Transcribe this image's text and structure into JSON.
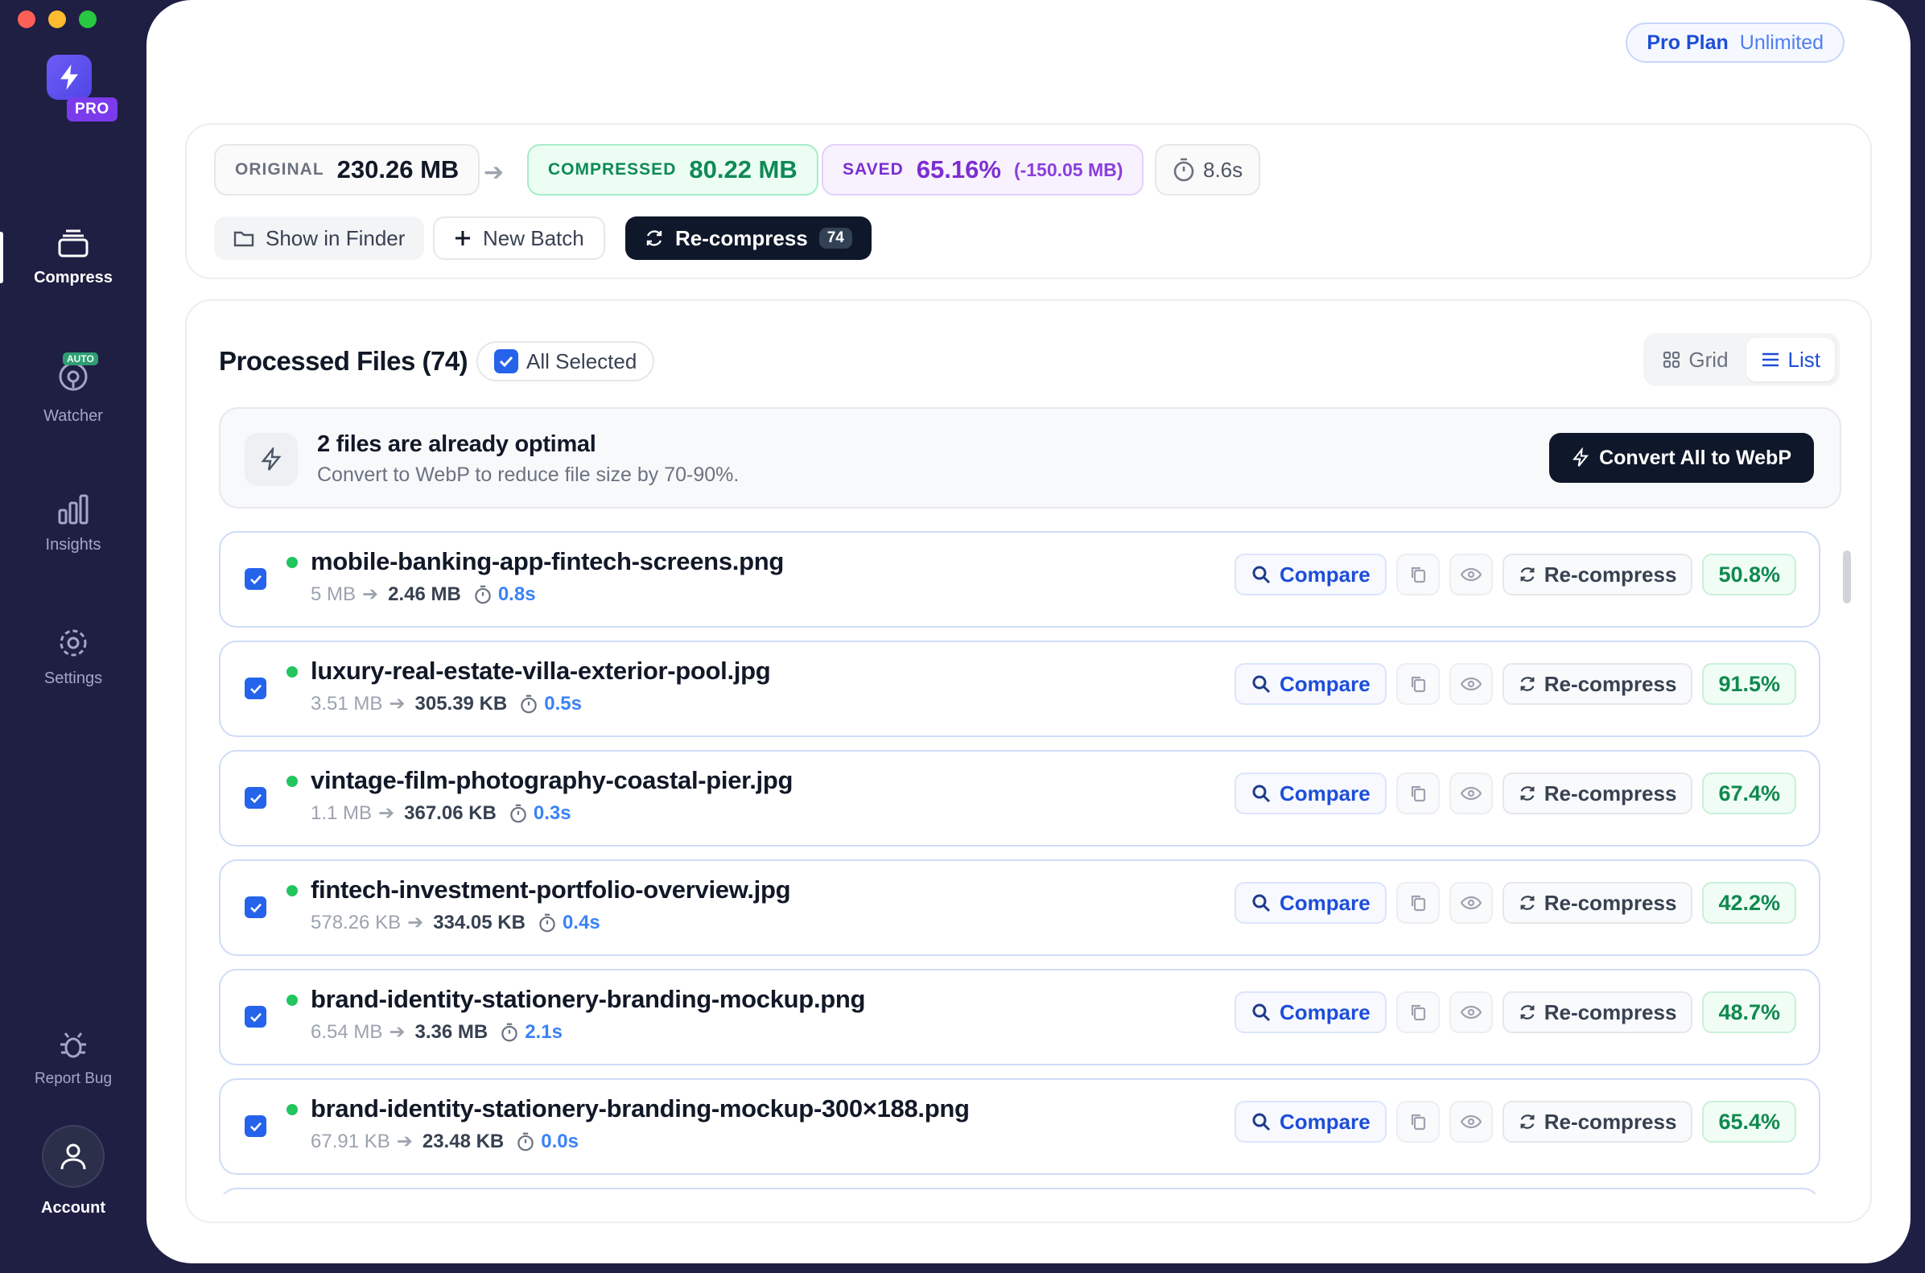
{
  "plan": {
    "name": "Pro Plan",
    "tier": "Unlimited"
  },
  "sidebar": {
    "pro_badge": "PRO",
    "auto_tag": "AUTO",
    "items": [
      {
        "label": "Compress",
        "icon": "stack-icon",
        "active": true
      },
      {
        "label": "Watcher",
        "icon": "watch-icon",
        "active": false
      },
      {
        "label": "Insights",
        "icon": "bar-chart-icon",
        "active": false
      },
      {
        "label": "Settings",
        "icon": "gear-icon",
        "active": false
      },
      {
        "label": "Report Bug",
        "icon": "bug-icon",
        "active": false
      },
      {
        "label": "Account",
        "icon": "user-icon",
        "active": false
      }
    ]
  },
  "stats": {
    "original_label": "ORIGINAL",
    "original_value": "230.26 MB",
    "compressed_label": "COMPRESSED",
    "compressed_value": "80.22 MB",
    "saved_label": "SAVED",
    "saved_value": "65.16%",
    "saved_delta": "(-150.05 MB)",
    "time_value": "8.6s"
  },
  "actions": {
    "show_in_finder": "Show in Finder",
    "new_batch": "New Batch",
    "recompress": "Re-compress",
    "recompress_count": "74"
  },
  "files": {
    "title": "Processed Files (74)",
    "all_selected": "All Selected",
    "view_grid": "Grid",
    "view_list": "List",
    "optimal_title": "2 files are already optimal",
    "optimal_sub": "Convert to WebP to reduce file size by 70-90%.",
    "convert_button": "Convert All to WebP",
    "compare_label": "Compare",
    "recompress_label": "Re-compress",
    "rows": [
      {
        "name": "mobile-banking-app-fintech-screens.png",
        "orig": "5 MB",
        "new": "2.46 MB",
        "time": "0.8s",
        "pct": "50.8%"
      },
      {
        "name": "luxury-real-estate-villa-exterior-pool.jpg",
        "orig": "3.51 MB",
        "new": "305.39 KB",
        "time": "0.5s",
        "pct": "91.5%"
      },
      {
        "name": "vintage-film-photography-coastal-pier.jpg",
        "orig": "1.1 MB",
        "new": "367.06 KB",
        "time": "0.3s",
        "pct": "67.4%"
      },
      {
        "name": "fintech-investment-portfolio-overview.jpg",
        "orig": "578.26 KB",
        "new": "334.05 KB",
        "time": "0.4s",
        "pct": "42.2%"
      },
      {
        "name": "brand-identity-stationery-branding-mockup.png",
        "orig": "6.54 MB",
        "new": "3.36 MB",
        "time": "2.1s",
        "pct": "48.7%"
      },
      {
        "name": "brand-identity-stationery-branding-mockup-300×188.png",
        "orig": "67.91 KB",
        "new": "23.48 KB",
        "time": "0.0s",
        "pct": "65.4%"
      }
    ]
  }
}
